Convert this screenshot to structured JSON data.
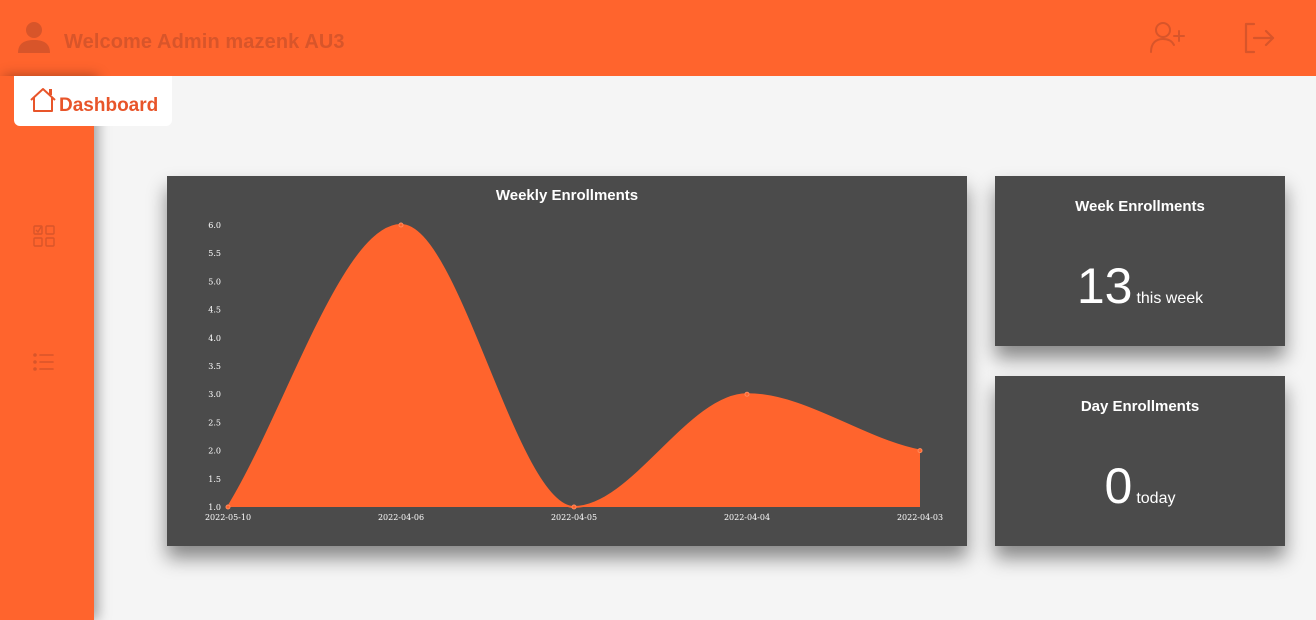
{
  "header": {
    "welcome_text": "Welcome Admin mazenk AU3",
    "icons": {
      "user": "user-icon",
      "add_user": "add-user-icon",
      "logout": "logout-icon"
    }
  },
  "nav": {
    "active_tab": "Dashboard",
    "sidebar_icons": [
      "grid-check-icon",
      "list-icon"
    ]
  },
  "colors": {
    "accent": "#ff642d",
    "card_bg": "#4b4b4b",
    "page_bg": "#f5f5f5",
    "text_on_card": "#ffffff"
  },
  "chart": {
    "title": "Weekly Enrollments"
  },
  "chart_data": {
    "type": "area",
    "title": "Weekly Enrollments",
    "categories": [
      "2022-05-10",
      "2022-04-06",
      "2022-04-05",
      "2022-04-04",
      "2022-04-03"
    ],
    "series": [
      {
        "values": [
          1,
          6,
          1,
          3,
          2
        ]
      }
    ],
    "ylim": [
      1.0,
      6.0
    ],
    "yticks": [
      "1.0",
      "1.5",
      "2.0",
      "2.5",
      "3.0",
      "3.5",
      "4.0",
      "4.5",
      "5.0",
      "5.5",
      "6.0"
    ],
    "xlabel": "",
    "ylabel": "",
    "grid": false,
    "legend": "none",
    "curve": "smooth"
  },
  "stats": {
    "week": {
      "title": "Week Enrollments",
      "value": "13",
      "unit": "this week"
    },
    "day": {
      "title": "Day Enrollments",
      "value": "0",
      "unit": "today"
    }
  }
}
